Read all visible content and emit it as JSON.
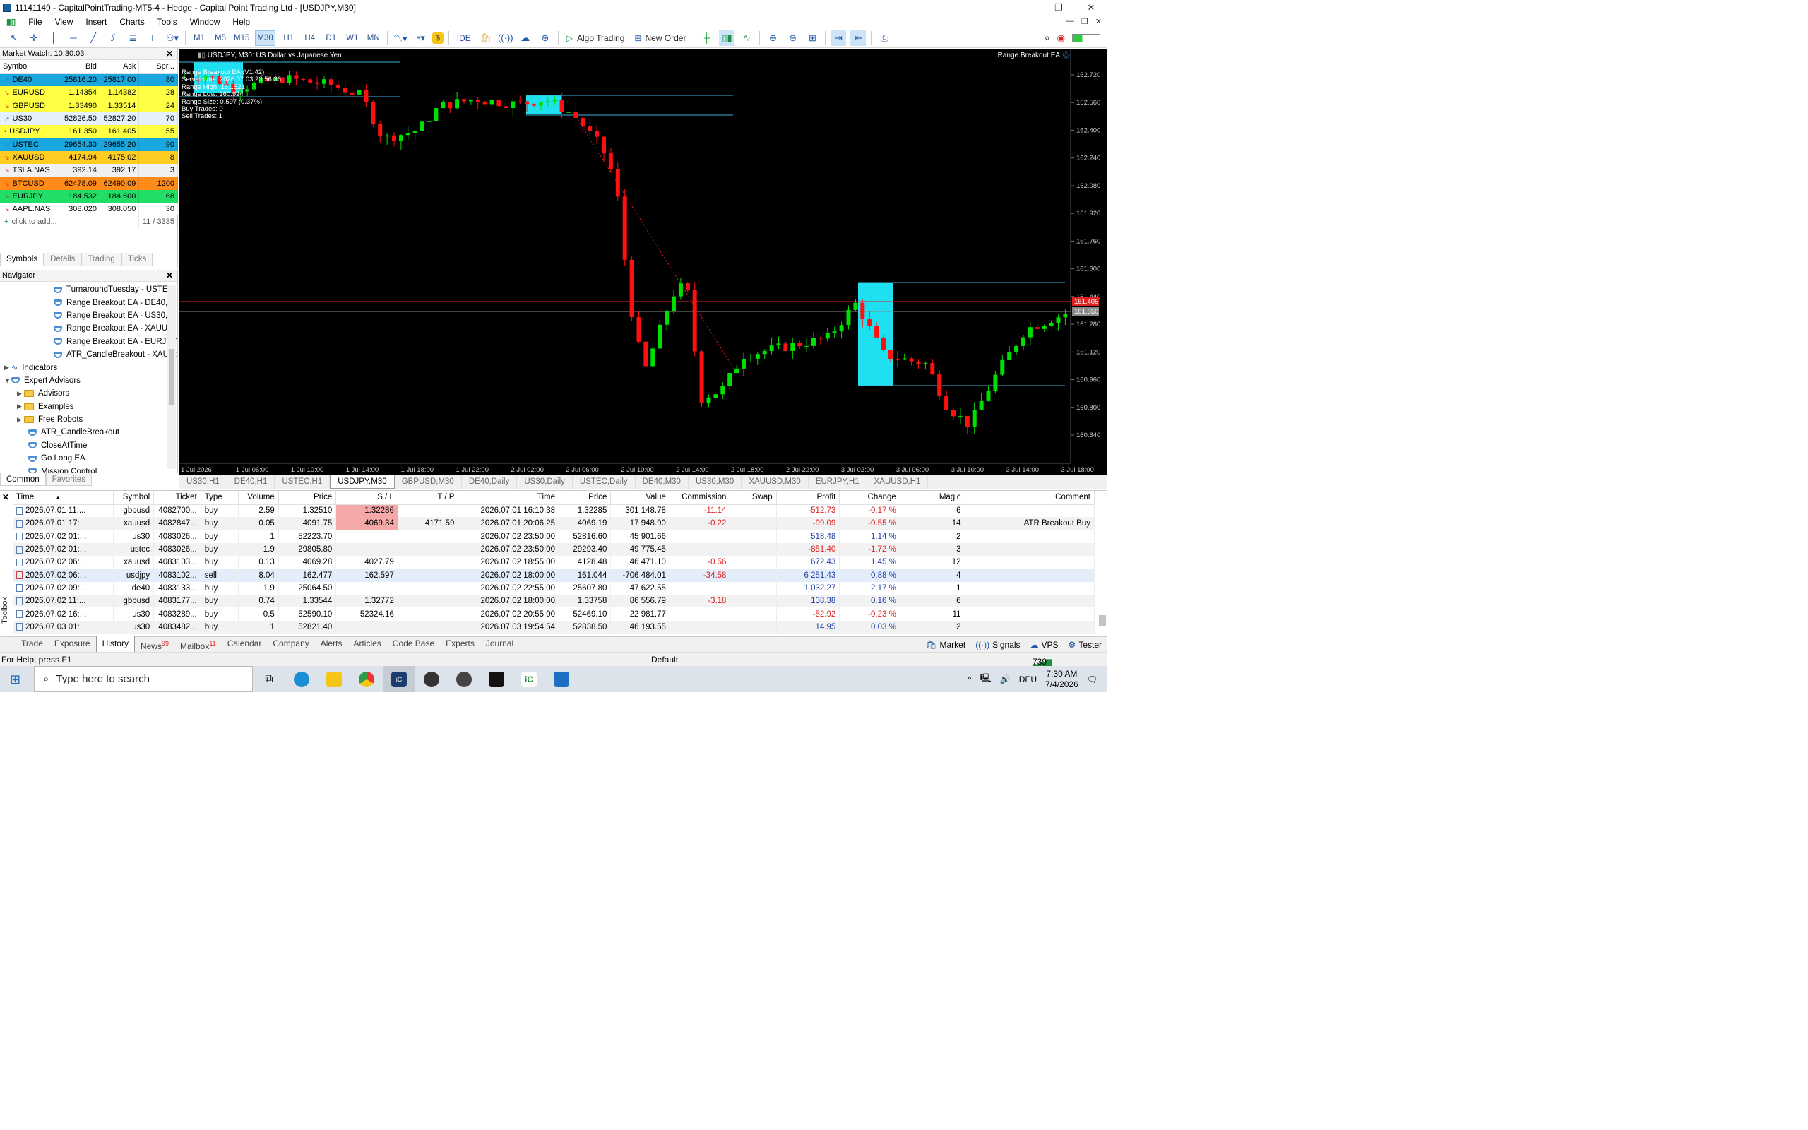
{
  "window": {
    "title": "11141149 - CapitalPointTrading-MT5-4 - Hedge - Capital Point Trading Ltd - [USDJPY,M30]"
  },
  "menu": [
    "File",
    "View",
    "Insert",
    "Charts",
    "Tools",
    "Window",
    "Help"
  ],
  "toolbar": {
    "timeframes": [
      "M1",
      "M5",
      "M15",
      "M30",
      "H1",
      "H4",
      "D1",
      "W1",
      "MN"
    ],
    "active_tf": "M30",
    "ide": "IDE",
    "algo": "Algo Trading",
    "new_order": "New Order"
  },
  "market_watch": {
    "title": "Market Watch: 10:30:03",
    "headers": [
      "Symbol",
      "Bid",
      "Ask",
      "Spr..."
    ],
    "rows": [
      {
        "sym": "DE40",
        "bid": "25816.20",
        "ask": "25817.00",
        "spr": "80",
        "bg": "#1aa7e0",
        "dir": "up"
      },
      {
        "sym": "EURUSD",
        "bid": "1.14354",
        "ask": "1.14382",
        "spr": "28",
        "bg": "#ffff44",
        "dir": "dn"
      },
      {
        "sym": "GBPUSD",
        "bid": "1.33490",
        "ask": "1.33514",
        "spr": "24",
        "bg": "#ffff44",
        "dir": "dn"
      },
      {
        "sym": "US30",
        "bid": "52826.50",
        "ask": "52827.20",
        "spr": "70",
        "bg": "#e4f0fa",
        "dir": "up"
      },
      {
        "sym": "USDJPY",
        "bid": "161.350",
        "ask": "161.405",
        "spr": "55",
        "bg": "#ffff44",
        "dir": "dot"
      },
      {
        "sym": "USTEC",
        "bid": "29654.30",
        "ask": "29655.20",
        "spr": "90",
        "bg": "#1aa7e0",
        "dir": "up"
      },
      {
        "sym": "XAUUSD",
        "bid": "4174.94",
        "ask": "4175.02",
        "spr": "8",
        "bg": "#ffcc22",
        "dir": "dn"
      },
      {
        "sym": "TSLA.NAS",
        "bid": "392.14",
        "ask": "392.17",
        "spr": "3",
        "bg": "#f0f0f0",
        "dir": "dn"
      },
      {
        "sym": "BTCUSD",
        "bid": "62478.09",
        "ask": "62490.09",
        "spr": "1200",
        "bg": "#ff8c1a",
        "dir": "dn"
      },
      {
        "sym": "EURJPY",
        "bid": "184.532",
        "ask": "184.600",
        "spr": "68",
        "bg": "#22dd66",
        "dir": "dn"
      },
      {
        "sym": "AAPL.NAS",
        "bid": "308.020",
        "ask": "308.050",
        "spr": "30",
        "bg": "#ffffff",
        "dir": "dn"
      }
    ],
    "add_label": "click to add...",
    "count": "11 / 3335",
    "tabs": [
      "Symbols",
      "Details",
      "Trading",
      "Ticks"
    ]
  },
  "navigator": {
    "title": "Navigator",
    "items": [
      {
        "label": "TurnaroundTuesday - USTEC,",
        "indent": 76,
        "icon": "hat"
      },
      {
        "label": "Range Breakout EA - DE40,M",
        "indent": 76,
        "icon": "hat"
      },
      {
        "label": "Range Breakout EA - US30,M",
        "indent": 76,
        "icon": "hat"
      },
      {
        "label": "Range Breakout EA - XAUUS",
        "indent": 76,
        "icon": "hat"
      },
      {
        "label": "Range Breakout EA - EURJPY",
        "indent": 76,
        "icon": "hat"
      },
      {
        "label": "ATR_CandleBreakout - XAUU:",
        "indent": 76,
        "icon": "hat"
      },
      {
        "label": "Indicators",
        "indent": 6,
        "icon": "ind",
        "tri": "›"
      },
      {
        "label": "Expert Advisors",
        "indent": 6,
        "icon": "hat",
        "tri": "v"
      },
      {
        "label": "Advisors",
        "indent": 24,
        "icon": "folder",
        "tri": "›"
      },
      {
        "label": "Examples",
        "indent": 24,
        "icon": "folder",
        "tri": "›"
      },
      {
        "label": "Free Robots",
        "indent": 24,
        "icon": "folder",
        "tri": "›"
      },
      {
        "label": "ATR_CandleBreakout",
        "indent": 40,
        "icon": "hat"
      },
      {
        "label": "CloseAtTime",
        "indent": 40,
        "icon": "hat"
      },
      {
        "label": "Go Long EA",
        "indent": 40,
        "icon": "hat"
      },
      {
        "label": "Mission Control",
        "indent": 40,
        "icon": "hat"
      }
    ],
    "tabs": [
      "Common",
      "Favorites"
    ]
  },
  "chart": {
    "header": "USDJPY, M30:  US Dollar vs Japanese Yen",
    "ea_name": "Range Breakout EA",
    "info": [
      "Range Breakout EA (V1.42)",
      "Server time: 2026.07.03 23:56:36",
      "Range High: 161.521",
      "Range Low: 160.924",
      "Range Size: 0.597 (0.37%)",
      "Buy Trades: 0",
      "Sell Trades: 1"
    ],
    "price_labels": [
      "162.720",
      "162.560",
      "162.400",
      "162.240",
      "162.080",
      "161.920",
      "161.760",
      "161.600",
      "161.440",
      "161.280",
      "161.120",
      "160.960",
      "160.800",
      "160.640"
    ],
    "bid_tag": "161.405",
    "ask_tag": "161.350",
    "time_labels": [
      "1 Jul 2026",
      "1 Jul 06:00",
      "1 Jul 10:00",
      "1 Jul 14:00",
      "1 Jul 18:00",
      "1 Jul 22:00",
      "2 Jul 02:00",
      "2 Jul 06:00",
      "2 Jul 10:00",
      "2 Jul 14:00",
      "2 Jul 18:00",
      "2 Jul 22:00",
      "3 Jul 02:00",
      "3 Jul 06:00",
      "3 Jul 10:00",
      "3 Jul 14:00",
      "3 Jul 18:00"
    ],
    "tabs": [
      "US30,H1",
      "DE40,H1",
      "USTEC,H1",
      "USDJPY,M30",
      "GBPUSD,M30",
      "DE40,Daily",
      "US30,Daily",
      "USTEC,Daily",
      "DE40,M30",
      "US30,M30",
      "XAUUSD,M30",
      "EURJPY,H1",
      "XAUUSD,H1"
    ],
    "active_tab": "USDJPY,M30"
  },
  "history": {
    "headers": [
      "Time",
      "Symbol",
      "Ticket",
      "Type",
      "Volume",
      "Price",
      "S / L",
      "T / P",
      "Time",
      "Price",
      "Value",
      "Commission",
      "Swap",
      "Profit",
      "Change",
      "Magic",
      "Comment"
    ],
    "rows": [
      [
        "2026.07.01 11:...",
        "gbpusd",
        "4082700...",
        "buy",
        "2.59",
        "1.32510",
        "1.32286",
        "",
        "2026.07.01 16:10:38",
        "1.32285",
        "301 148.78",
        "-11.14",
        "",
        "-512.73",
        "-0.17 %",
        "6",
        ""
      ],
      [
        "2026.07.01 17:...",
        "xauusd",
        "4082847...",
        "buy",
        "0.05",
        "4091.75",
        "4069.34",
        "4171.59",
        "2026.07.01 20:06:25",
        "4069.19",
        "17 948.90",
        "-0.22",
        "",
        "-99.09",
        "-0.55 %",
        "14",
        "ATR Breakout Buy"
      ],
      [
        "2026.07.02 01:...",
        "us30",
        "4083026...",
        "buy",
        "1",
        "52223.70",
        "",
        "",
        "2026.07.02 23:50:00",
        "52816.60",
        "45 901.66",
        "",
        "",
        "518.48",
        "1.14 %",
        "2",
        ""
      ],
      [
        "2026.07.02 01:...",
        "ustec",
        "4083026...",
        "buy",
        "1.9",
        "29805.80",
        "",
        "",
        "2026.07.02 23:50:00",
        "29293.40",
        "49 775.45",
        "",
        "",
        "-851.40",
        "-1.72 %",
        "3",
        ""
      ],
      [
        "2026.07.02 06:...",
        "xauusd",
        "4083103...",
        "buy",
        "0.13",
        "4069.28",
        "4027.79",
        "",
        "2026.07.02 18:55:00",
        "4128.48",
        "46 471.10",
        "-0.56",
        "",
        "672.43",
        "1.45 %",
        "12",
        ""
      ],
      [
        "2026.07.02 06:...",
        "usdjpy",
        "4083102...",
        "sell",
        "8.04",
        "162.477",
        "162.597",
        "",
        "2026.07.02 18:00:00",
        "161.044",
        "-706 484.01",
        "-34.58",
        "",
        "6 251.43",
        "0.88 %",
        "4",
        ""
      ],
      [
        "2026.07.02 09:...",
        "de40",
        "4083133...",
        "buy",
        "1.9",
        "25064.50",
        "",
        "",
        "2026.07.02 22:55:00",
        "25607.80",
        "47 622.55",
        "",
        "",
        "1 032.27",
        "2.17 %",
        "1",
        ""
      ],
      [
        "2026.07.02 11:...",
        "gbpusd",
        "4083177...",
        "buy",
        "0.74",
        "1.33544",
        "1.32772",
        "",
        "2026.07.02 18:00:00",
        "1.33758",
        "86 556.79",
        "-3.18",
        "",
        "138.38",
        "0.16 %",
        "6",
        ""
      ],
      [
        "2026.07.02 16:...",
        "us30",
        "4083289...",
        "buy",
        "0.5",
        "52590.10",
        "52324.16",
        "",
        "2026.07.02 20:55:00",
        "52469.10",
        "22 981.77",
        "",
        "",
        "-52.92",
        "-0.23 %",
        "11",
        ""
      ],
      [
        "2026.07.03 01:...",
        "us30",
        "4083482...",
        "buy",
        "1",
        "52821.40",
        "",
        "",
        "2026.07.03 19:54:54",
        "52838.50",
        "46 193.55",
        "",
        "",
        "14.95",
        "0.03 %",
        "2",
        ""
      ]
    ],
    "side_label": "Toolbox"
  },
  "bottom_tabs": [
    {
      "label": "Trade"
    },
    {
      "label": "Exposure"
    },
    {
      "label": "History",
      "active": true
    },
    {
      "label": "News",
      "badge": "99"
    },
    {
      "label": "Mailbox",
      "badge": "11"
    },
    {
      "label": "Calendar"
    },
    {
      "label": "Company"
    },
    {
      "label": "Alerts"
    },
    {
      "label": "Articles"
    },
    {
      "label": "Code Base"
    },
    {
      "label": "Experts"
    },
    {
      "label": "Journal"
    }
  ],
  "bottom_right": [
    "Market",
    "Signals",
    "VPS",
    "Tester"
  ],
  "status": {
    "help": "For Help, press F1",
    "profile": "Default",
    "traffic": "739 / 1 Mb"
  },
  "taskbar": {
    "search_placeholder": "Type here to search",
    "lang": "DEU",
    "time": "7:30 AM",
    "date": "7/4/2026"
  }
}
